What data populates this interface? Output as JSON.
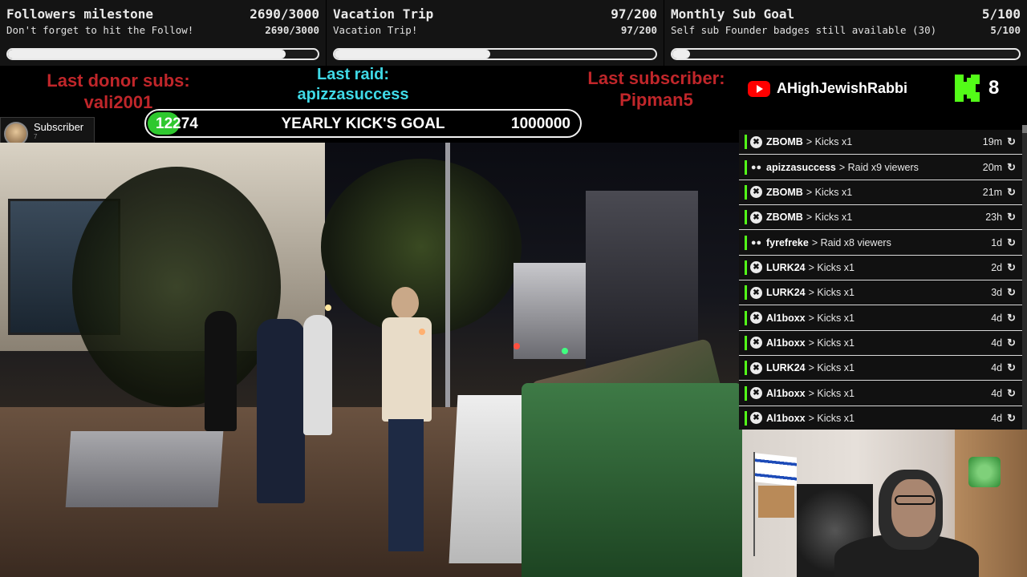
{
  "goals": [
    {
      "title": "Followers milestone",
      "count": "2690/3000",
      "subtitle": "Don't forget to hit the Follow!",
      "subcount": "2690/3000",
      "progress": 0.897
    },
    {
      "title": "Vacation Trip",
      "count": "97/200",
      "subtitle": "Vacation Trip!",
      "subcount": "97/200",
      "progress": 0.485
    },
    {
      "title": "Monthly Sub Goal",
      "count": "5/100",
      "subtitle": "Self sub Founder badges still available (30)",
      "subcount": "5/100",
      "progress": 0.05
    }
  ],
  "last_donor": {
    "label": "Last donor subs:",
    "name": "vali2001"
  },
  "last_raid": {
    "label": "Last raid:",
    "name": "apizzasuccess"
  },
  "last_subscriber": {
    "label": "Last subscriber:",
    "name": "Pipman5"
  },
  "kick_goal": {
    "current": "12274",
    "title": "YEARLY KICK'S GOAL",
    "target": "1000000"
  },
  "youtube": {
    "icon": "youtube-icon",
    "channel": "AHighJewishRabbi"
  },
  "kick": {
    "icon": "kick-logo-icon",
    "count": "8"
  },
  "subscriber_badge": {
    "label": "Subscriber",
    "sublabel": "7"
  },
  "feed": [
    {
      "type": "kick",
      "user": "ZBOMB",
      "desc": "> Kicks x1",
      "time": "19m"
    },
    {
      "type": "raid",
      "user": "apizzasuccess",
      "desc": "> Raid x9 viewers",
      "time": "20m"
    },
    {
      "type": "kick",
      "user": "ZBOMB",
      "desc": "> Kicks x1",
      "time": "21m"
    },
    {
      "type": "kick",
      "user": "ZBOMB",
      "desc": "> Kicks x1",
      "time": "23h"
    },
    {
      "type": "raid",
      "user": "fyrefreke",
      "desc": "> Raid x8 viewers",
      "time": "1d"
    },
    {
      "type": "kick",
      "user": "LURK24",
      "desc": "> Kicks x1",
      "time": "2d"
    },
    {
      "type": "kick",
      "user": "LURK24",
      "desc": "> Kicks x1",
      "time": "3d"
    },
    {
      "type": "kick",
      "user": "Al1boxx",
      "desc": "> Kicks x1",
      "time": "4d"
    },
    {
      "type": "kick",
      "user": "Al1boxx",
      "desc": "> Kicks x1",
      "time": "4d"
    },
    {
      "type": "kick",
      "user": "LURK24",
      "desc": "> Kicks x1",
      "time": "4d"
    },
    {
      "type": "kick",
      "user": "Al1boxx",
      "desc": "> Kicks x1",
      "time": "4d"
    },
    {
      "type": "kick",
      "user": "Al1boxx",
      "desc": "> Kicks x1",
      "time": "4d"
    }
  ],
  "colors": {
    "accent_green": "#53fc18",
    "alert_red": "#c0262a",
    "raid_cyan": "#3fd9e6"
  }
}
